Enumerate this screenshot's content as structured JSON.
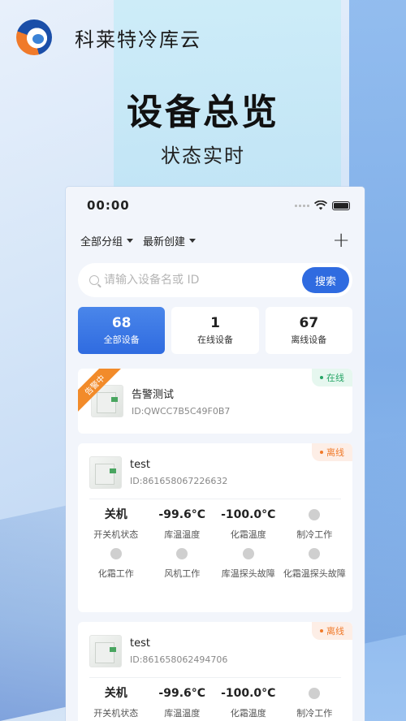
{
  "brand": {
    "name": "科莱特冷库云"
  },
  "headline": "设备总览",
  "subline": "状态实时",
  "status_bar": {
    "time": "00:00"
  },
  "toolbar": {
    "group_filter": "全部分组",
    "sort_filter": "最新创建",
    "add_icon": "plus-icon"
  },
  "search": {
    "placeholder": "请输入设备名或 ID",
    "button": "搜索"
  },
  "stats": [
    {
      "count": "68",
      "label": "全部设备",
      "active": true
    },
    {
      "count": "1",
      "label": "在线设备",
      "active": false
    },
    {
      "count": "67",
      "label": "离线设备",
      "active": false
    }
  ],
  "devices": [
    {
      "ribbon": "告警中",
      "status": "在线",
      "name": "告警测试",
      "id": "ID:QWCC7B5C49F0B7"
    },
    {
      "status": "离线",
      "name": "test",
      "id": "ID:861658067226632",
      "metrics": [
        {
          "value": "关机",
          "label": "开关机状态"
        },
        {
          "value": "-99.6°C",
          "label": "库温温度"
        },
        {
          "value": "-100.0°C",
          "label": "化霜温度"
        },
        {
          "value": "",
          "label": "制冷工作"
        },
        {
          "value": "",
          "label": "化霜工作"
        },
        {
          "value": "",
          "label": "风机工作"
        },
        {
          "value": "",
          "label": "库温探头故障"
        },
        {
          "value": "",
          "label": "化霜温探头故障"
        }
      ]
    },
    {
      "status": "离线",
      "name": "test",
      "id": "ID:861658062494706",
      "metrics": [
        {
          "value": "关机",
          "label": "开关机状态"
        },
        {
          "value": "-99.6°C",
          "label": "库温温度"
        },
        {
          "value": "-100.0°C",
          "label": "化霜温度"
        },
        {
          "value": "",
          "label": "制冷工作"
        }
      ]
    }
  ],
  "colors": {
    "accent": "#2f6be0",
    "online": "#27a566",
    "offline": "#f07a2a",
    "alarm": "#f28b2a"
  }
}
